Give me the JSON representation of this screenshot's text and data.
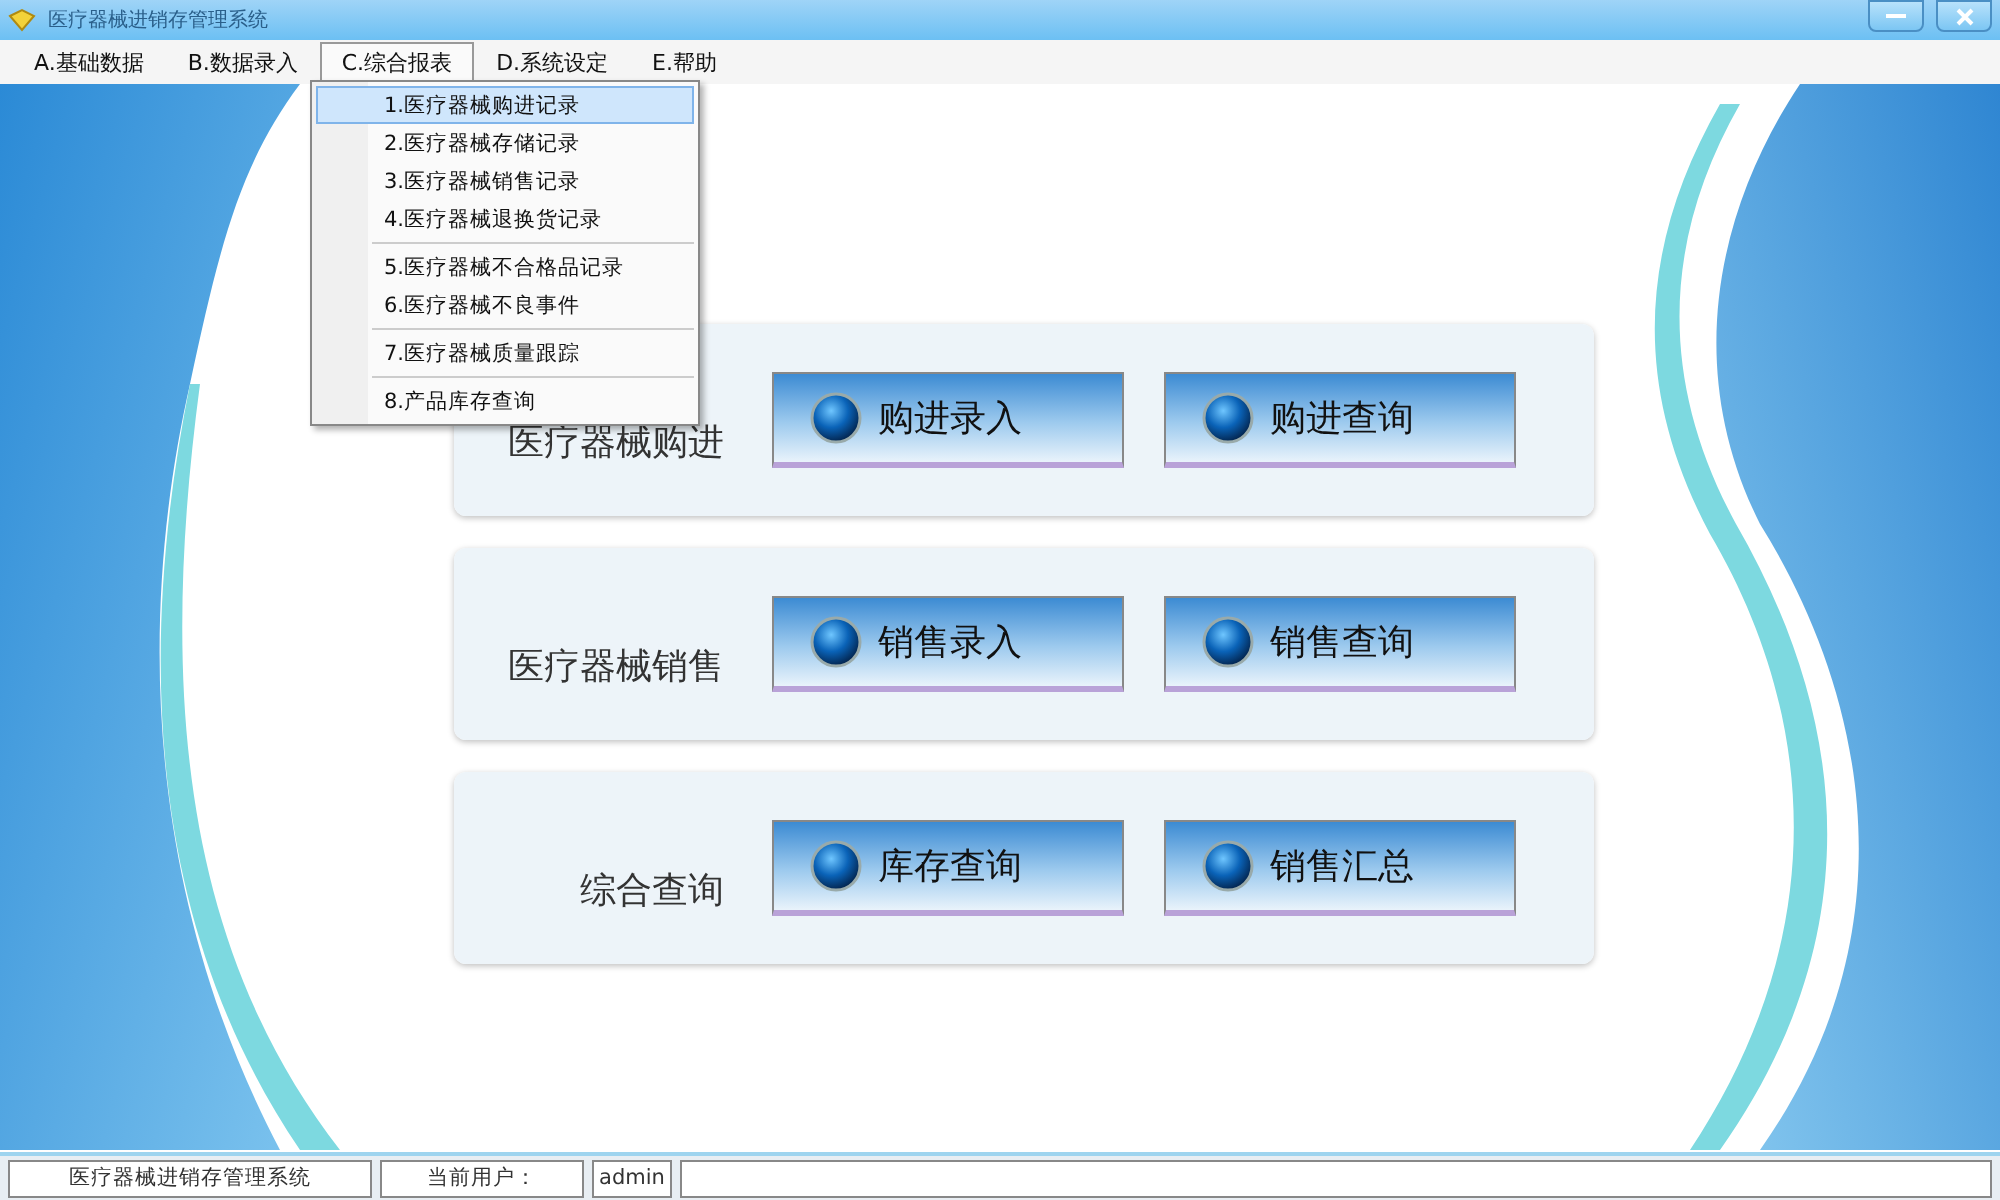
{
  "window": {
    "title": "医疗器械进销存管理系统"
  },
  "menu_bar": [
    {
      "label": "A.基础数据",
      "selected": false
    },
    {
      "label": "B.数据录入",
      "selected": false
    },
    {
      "label": "C.综合报表",
      "selected": true
    },
    {
      "label": "D.系统设定",
      "selected": false
    },
    {
      "label": "E.帮助",
      "selected": false
    }
  ],
  "dropdown": [
    {
      "kind": "item",
      "label": "1.医疗器械购进记录",
      "selected": true
    },
    {
      "kind": "item",
      "label": "2.医疗器械存储记录",
      "selected": false
    },
    {
      "kind": "item",
      "label": "3.医疗器械销售记录",
      "selected": false
    },
    {
      "kind": "item",
      "label": "4.医疗器械退换货记录",
      "selected": false
    },
    {
      "kind": "separator"
    },
    {
      "kind": "item",
      "label": "5.医疗器械不合格品记录",
      "selected": false
    },
    {
      "kind": "item",
      "label": "6.医疗器械不良事件",
      "selected": false
    },
    {
      "kind": "separator"
    },
    {
      "kind": "item",
      "label": "7.医疗器械质量跟踪",
      "selected": false
    },
    {
      "kind": "separator"
    },
    {
      "kind": "item",
      "label": "8.产品库存查询",
      "selected": false
    }
  ],
  "panels": [
    {
      "label": "医疗器械购进",
      "buttons": [
        "购进录入",
        "购进查询"
      ]
    },
    {
      "label": "医疗器械销售",
      "buttons": [
        "销售录入",
        "销售查询"
      ]
    },
    {
      "label": "综合查询",
      "buttons": [
        "库存查询",
        "销售汇总"
      ]
    }
  ],
  "status_bar": {
    "app_name": "医疗器械进销存管理系统",
    "user_label": "当前用户：",
    "user": "admin"
  }
}
